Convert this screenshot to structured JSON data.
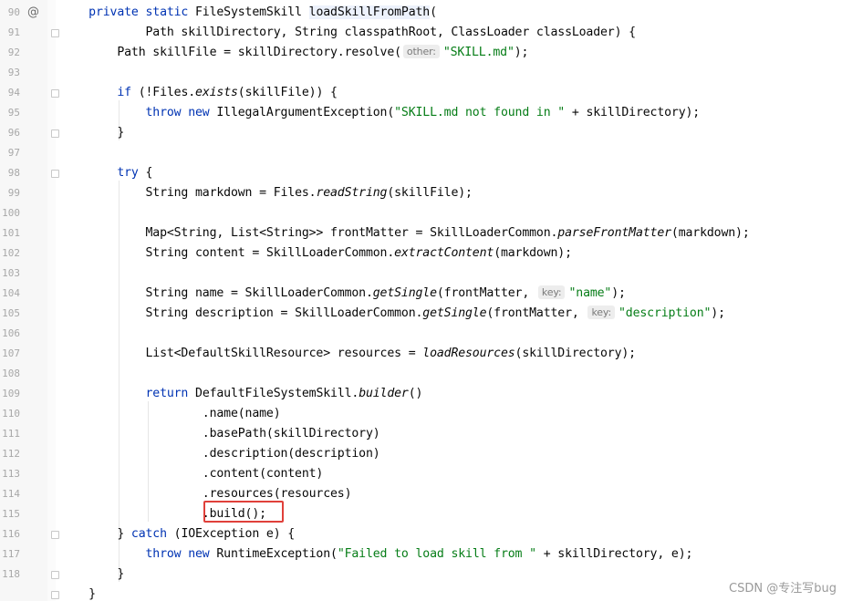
{
  "line_numbers": [
    "90",
    "91",
    "92",
    "93",
    "94",
    "95",
    "96",
    "97",
    "98",
    "99",
    "100",
    "101",
    "102",
    "103",
    "104",
    "105",
    "106",
    "107",
    "108",
    "109",
    "110",
    "111",
    "112",
    "113",
    "114",
    "115",
    "116",
    "117",
    "118"
  ],
  "gutter_marker": "@",
  "code": {
    "l90": {
      "indent": "    ",
      "t1": "private static ",
      "t2": "FileSystemSkill ",
      "t3": "loadSkillFromPath",
      "t4": "("
    },
    "l91": {
      "indent": "            ",
      "t1": "Path skillDirectory, String classpathRoot, ClassLoader classLoader) {"
    },
    "l92": {
      "indent": "        ",
      "t1": "Path skillFile = skillDirectory.resolve(",
      "hint": "other:",
      "str": "\"SKILL.md\"",
      "t2": ");"
    },
    "l94": {
      "indent": "        ",
      "kw": "if",
      "t1": " (!Files.",
      "it": "exists",
      "t2": "(skillFile)) {"
    },
    "l95": {
      "indent": "            ",
      "kw": "throw new",
      "t1": " IllegalArgumentException(",
      "str": "\"SKILL.md not found in \"",
      "t2": " + skillDirectory);"
    },
    "l96": {
      "indent": "        ",
      "t1": "}"
    },
    "l98": {
      "indent": "        ",
      "kw": "try",
      "t1": " {"
    },
    "l99": {
      "indent": "            ",
      "t1": "String markdown = Files.",
      "it": "readString",
      "t2": "(skillFile);"
    },
    "l101": {
      "indent": "            ",
      "t1": "Map<String, List<String>> frontMatter = SkillLoaderCommon.",
      "it": "parseFrontMatter",
      "t2": "(markdown);"
    },
    "l102": {
      "indent": "            ",
      "t1": "String content = SkillLoaderCommon.",
      "it": "extractContent",
      "t2": "(markdown);"
    },
    "l104": {
      "indent": "            ",
      "t1": "String name = SkillLoaderCommon.",
      "it": "getSingle",
      "t2": "(frontMatter, ",
      "hint": "key:",
      "str": "\"name\"",
      "t3": ");"
    },
    "l105": {
      "indent": "            ",
      "t1": "String description = SkillLoaderCommon.",
      "it": "getSingle",
      "t2": "(frontMatter, ",
      "hint": "key:",
      "str": "\"description\"",
      "t3": ");"
    },
    "l107": {
      "indent": "            ",
      "t1": "List<DefaultSkillResource> resources = ",
      "it": "loadResources",
      "t2": "(skillDirectory);"
    },
    "l109": {
      "indent": "            ",
      "kw": "return",
      "t1": " DefaultFileSystemSkill.",
      "it": "builder",
      "t2": "()"
    },
    "l110": {
      "indent": "                    ",
      "t1": ".name(name)"
    },
    "l111": {
      "indent": "                    ",
      "t1": ".basePath(skillDirectory)"
    },
    "l112": {
      "indent": "                    ",
      "t1": ".description(description)"
    },
    "l113": {
      "indent": "                    ",
      "t1": ".content(content)"
    },
    "l114": {
      "indent": "                    ",
      "t1": ".resources(resources)"
    },
    "l115": {
      "indent": "                    ",
      "t1": ".build();"
    },
    "l116": {
      "indent": "        ",
      "t1": "} ",
      "kw": "catch",
      "t2": " (IOException e) {"
    },
    "l117": {
      "indent": "            ",
      "kw": "throw new",
      "t1": " RuntimeException(",
      "str": "\"Failed to load skill from \"",
      "t2": " + skillDirectory, e);"
    },
    "l118": {
      "indent": "        ",
      "t1": "}"
    },
    "l119": {
      "indent": "    ",
      "t1": "}"
    }
  },
  "watermark": "CSDN @专注写bug",
  "colors": {
    "keyword": "#0033b3",
    "string": "#067d17",
    "highlight_box": "#e0403a",
    "declaration_bg": "#edf2fc"
  }
}
